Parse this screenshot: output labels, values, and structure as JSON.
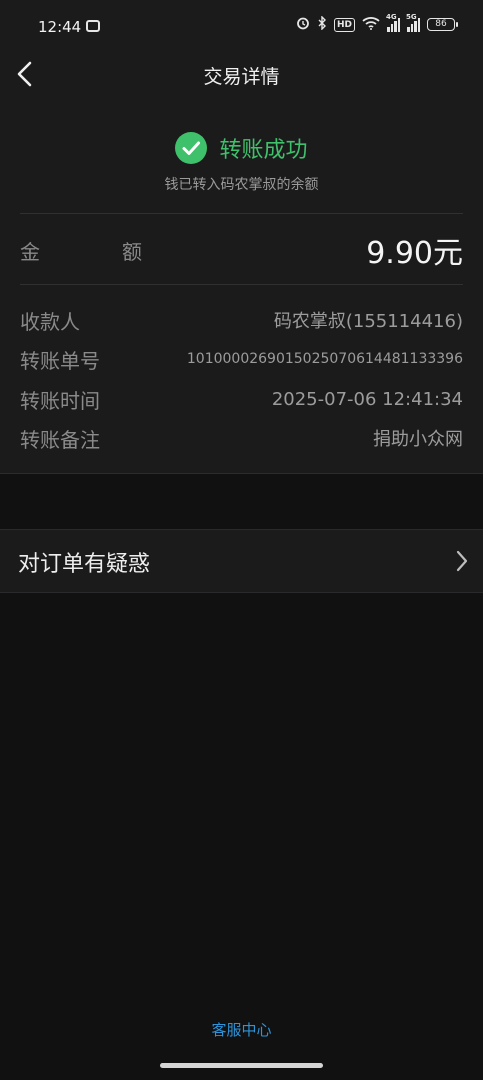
{
  "status_bar": {
    "time": "12:44",
    "hd_label": "HD",
    "net1": "4G",
    "net2": "5G",
    "battery": "86"
  },
  "nav": {
    "title": "交易详情"
  },
  "result": {
    "status": "转账成功",
    "subtitle": "钱已转入码农掌叔的余额"
  },
  "amount": {
    "label_a": "金",
    "label_b": "额",
    "value": "9.90元"
  },
  "details": [
    {
      "label": "收款人",
      "value": "码农掌叔(155114416)"
    },
    {
      "label": "转账单号",
      "value": "1010000269015025070614481133396"
    },
    {
      "label": "转账时间",
      "value": "2025-07-06  12:41:34"
    },
    {
      "label": "转账备注",
      "value": "捐助小众网"
    }
  ],
  "doubt": {
    "label": "对订单有疑惑"
  },
  "footer": {
    "service": "客服中心"
  },
  "colors": {
    "success": "#3fc06a",
    "link": "#2f93d8",
    "background": "#111112",
    "surface": "#1b1b1c"
  }
}
